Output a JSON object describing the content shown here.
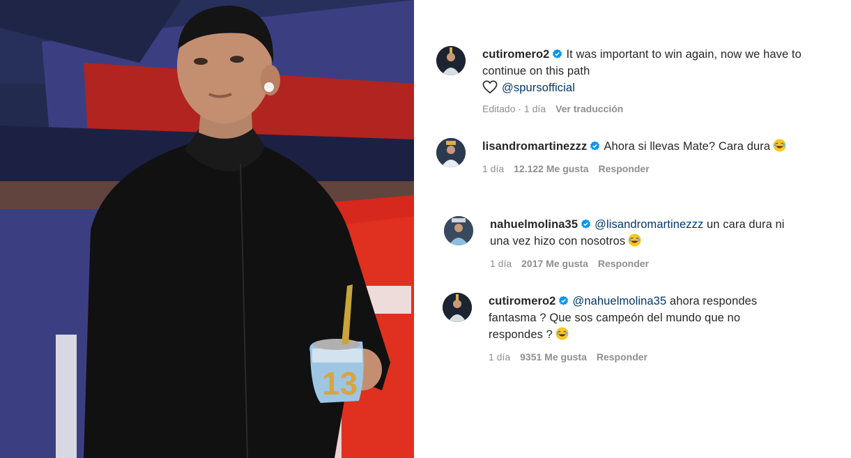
{
  "post": {
    "author": "cutiromero2",
    "caption": "It was important to win again, now we have to continue on this path",
    "mention": "@spursofficial",
    "meta_edited": "Editado · 1 día",
    "meta_translate": "Ver traducción"
  },
  "comments": [
    {
      "user": "lisandromartinezzz",
      "text": "Ahora si llevas Mate? Cara dura",
      "time": "1 día",
      "likes": "12.122 Me gusta",
      "reply": "Responder"
    },
    {
      "user": "nahuelmolina35",
      "mention": "@lisandromartinezzz",
      "text": "un cara dura ni una vez hizo con nosotros",
      "time": "1 día",
      "likes": "2017 Me gusta",
      "reply": "Responder"
    },
    {
      "user": "cutiromero2",
      "mention": "@nahuelmolina35",
      "text": "ahora respondes fantasma ? Que sos campeón del mundo que no respondes ?",
      "time": "1 día",
      "likes": "9351 Me gusta",
      "reply": "Responder"
    }
  ],
  "photo": {
    "mate_number": "13"
  },
  "colors": {
    "verified": "#0095f6",
    "mention": "#00376b",
    "meta": "#8e8e8e",
    "text": "#262626"
  },
  "icons": [
    "verified-badge-icon",
    "heart-icon",
    "laughing-emoji-icon"
  ]
}
